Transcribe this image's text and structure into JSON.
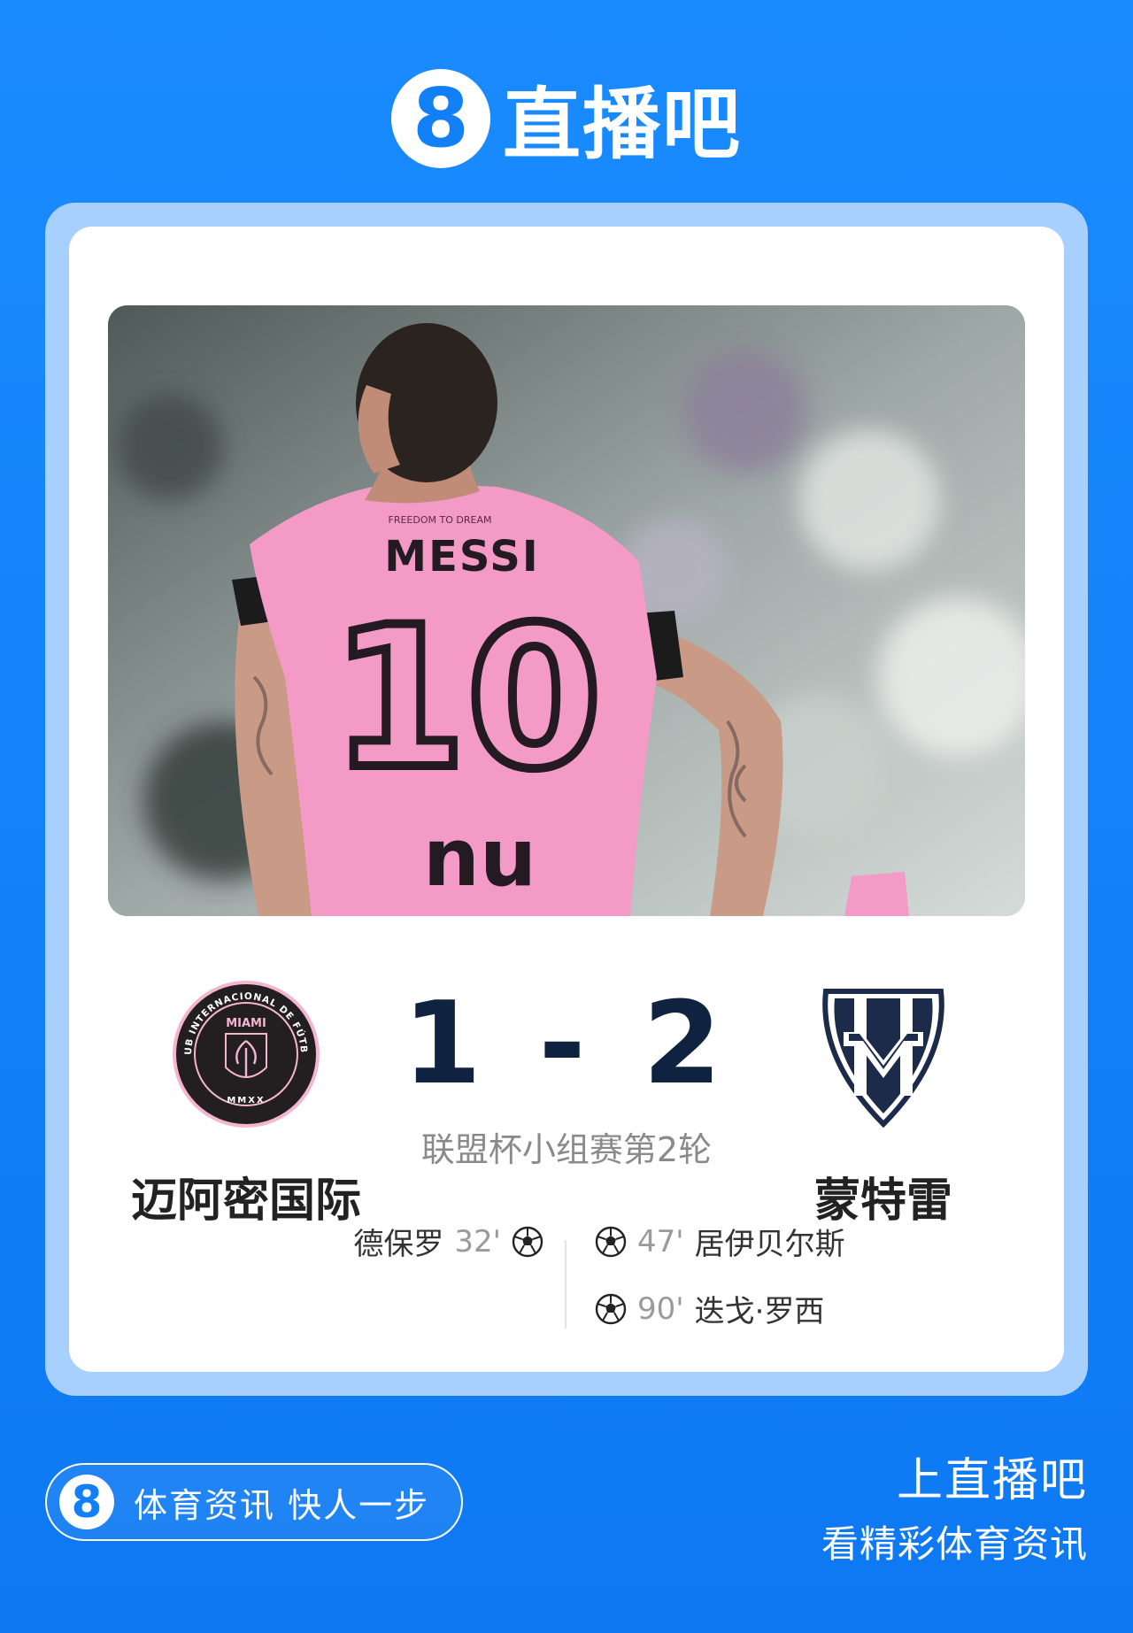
{
  "brand": {
    "badge": "8",
    "name": "直播吧"
  },
  "match": {
    "home_team": "迈阿密国际",
    "away_team": "蒙特雷",
    "score": "1 - 2",
    "round": "联盟杯小组赛第2轮",
    "home_goals": [
      {
        "scorer": "德保罗",
        "minute": "32'"
      }
    ],
    "away_goals": [
      {
        "scorer": "居伊贝尔斯",
        "minute": "47'"
      },
      {
        "scorer": "迭戈·罗西",
        "minute": "90'"
      }
    ]
  },
  "photo": {
    "jersey_name": "MESSI",
    "jersey_number": "10",
    "sponsor": "nu",
    "collar_text": "FREEDOM TO DREAM"
  },
  "logos": {
    "home_crest_top": "MIAMI",
    "home_crest_ring": "CLUB INTERNACIONAL DE FÚTBOL",
    "home_crest_bottom": "MMXX"
  },
  "footer": {
    "badge": "8",
    "slogan": "体育资讯 快人一步",
    "cta_line1": "上直播吧",
    "cta_line2": "看精彩体育资讯"
  },
  "colors": {
    "brand_blue": "#1180f6",
    "score": "#0f2340",
    "jersey_pink": "#f49ac7"
  }
}
